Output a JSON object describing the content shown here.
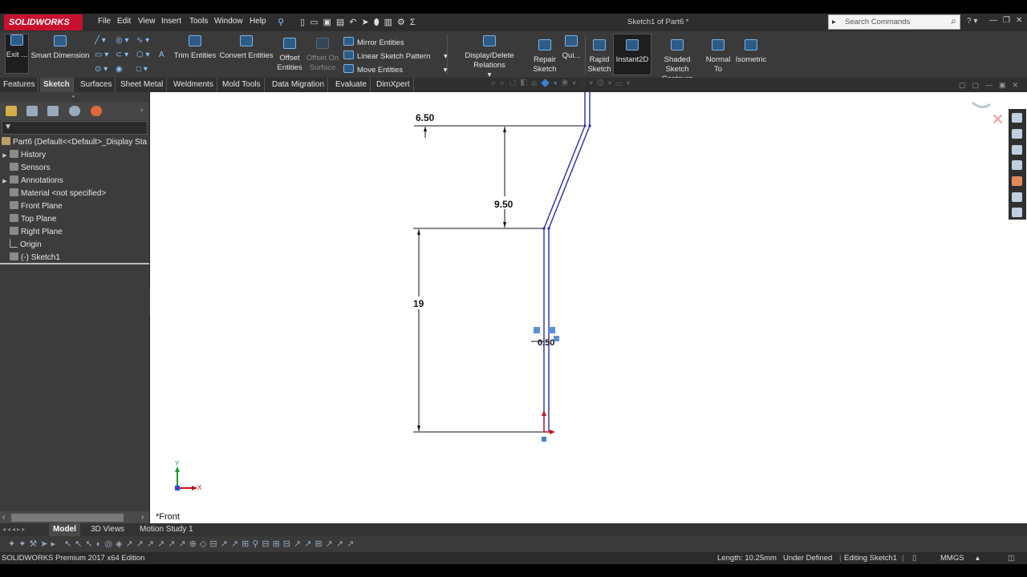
{
  "app": {
    "logo_text": "SOLIDWORKS",
    "document_title": "Sketch1 of Part6 *",
    "search_placeholder": "Search Commands"
  },
  "menu": [
    "File",
    "Edit",
    "View",
    "Insert",
    "Tools",
    "Window",
    "Help"
  ],
  "command_manager": {
    "exit_sketch": "Exit ...",
    "smart_dimension": "Smart Dimension",
    "trim_entities": "Trim Entities",
    "convert_entities": "Convert Entities",
    "offset_entities": [
      "Offset",
      "Entities"
    ],
    "offset_on_surface": [
      "Offset On",
      "Surface"
    ],
    "mirror_entities": "Mirror Entities",
    "linear_sketch_pattern": "Linear Sketch Pattern",
    "move_entities": "Move Entities",
    "display_delete_relations": "Display/Delete Relations",
    "repair_sketch": [
      "Repair",
      "Sketch"
    ],
    "quick_snaps": "Qui...",
    "rapid_sketch": [
      "Rapid",
      "Sketch"
    ],
    "instant2d": "Instant2D",
    "shaded_sketch_contours": [
      "Shaded Sketch",
      "Contours"
    ],
    "normal_to": [
      "Normal",
      "To"
    ],
    "isometric": "Isometric"
  },
  "tabs": [
    "Features",
    "Sketch",
    "Surfaces",
    "Sheet Metal",
    "Weldments",
    "Mold Tools",
    "Data Migration",
    "Evaluate",
    "DimXpert"
  ],
  "feature_tree": {
    "root": "Part6  (Default<<Default>_Display Sta",
    "items": [
      "History",
      "Sensors",
      "Annotations",
      "Material <not specified>",
      "Front Plane",
      "Top Plane",
      "Right Plane",
      "Origin",
      "(-) Sketch1"
    ]
  },
  "viewport": {
    "view_label": "*Front",
    "dimensions": [
      "6.50",
      "9.50",
      "19",
      "0.50"
    ],
    "axis_labels": {
      "x": "X",
      "y": "Y"
    }
  },
  "bottom_tabs": [
    "Model",
    "3D Views",
    "Motion Study 1"
  ],
  "status": {
    "edition": "SOLIDWORKS Premium 2017 x64 Edition",
    "length": "Length: 10.25mm",
    "state": "Under Defined",
    "editing": "Editing Sketch1",
    "units": "MMGS"
  },
  "colors": {
    "sketch_blue": "#2a2aa6",
    "dimension_black": "#111111",
    "brand_red": "#c8102e"
  }
}
